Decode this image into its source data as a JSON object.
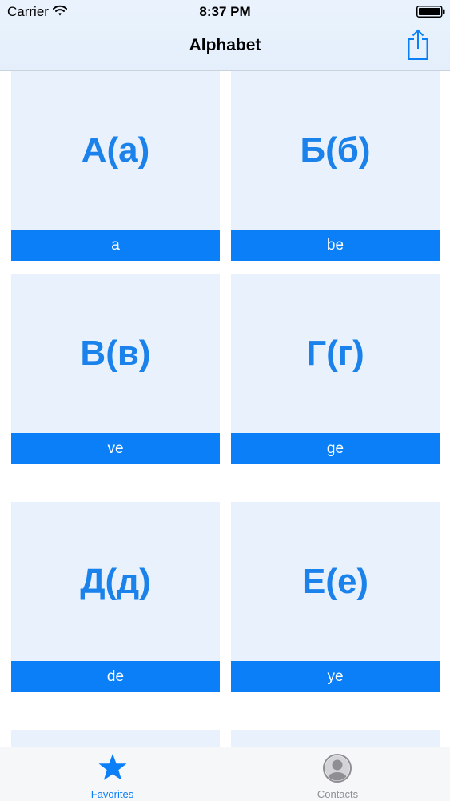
{
  "status_bar": {
    "carrier": "Carrier",
    "time": "8:37 PM"
  },
  "nav": {
    "title": "Alphabet",
    "share_icon": "share-icon"
  },
  "letters": [
    {
      "glyph": "А(а)",
      "name": "a"
    },
    {
      "glyph": "Б(б)",
      "name": "be"
    },
    {
      "glyph": "В(в)",
      "name": "ve"
    },
    {
      "glyph": "Г(г)",
      "name": "ge"
    },
    {
      "glyph": "Д(д)",
      "name": "de"
    },
    {
      "glyph": "Е(е)",
      "name": "ye"
    }
  ],
  "tabs": [
    {
      "label": "Favorites",
      "icon": "star-icon",
      "selected": true
    },
    {
      "label": "Contacts",
      "icon": "contacts-icon",
      "selected": false
    }
  ],
  "colors": {
    "accent": "#0a7ff7",
    "letter_text": "#1a82ea",
    "card_background": "#e8f1fc",
    "inactive_tab": "#8e8e93"
  }
}
